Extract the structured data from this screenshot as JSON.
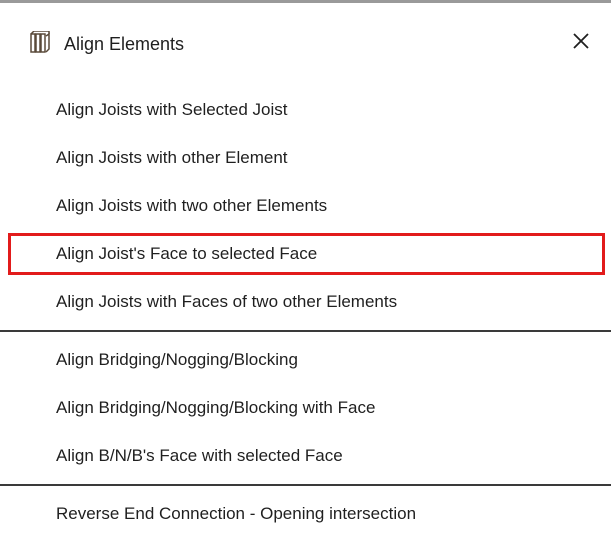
{
  "window": {
    "title": "Align Elements",
    "close_glyph": "✕"
  },
  "icons": {
    "title_icon": "joists-icon",
    "close_icon": "close-icon"
  },
  "colors": {
    "highlight_border": "#e21b1b",
    "separator": "#3a3a3a",
    "text": "#1f1f1f",
    "background": "#ffffff"
  },
  "menu": {
    "groups": [
      {
        "items": [
          {
            "label": "Align Joists with Selected Joist"
          },
          {
            "label": "Align Joists with other Element"
          },
          {
            "label": "Align Joists with two other Elements"
          },
          {
            "label": "Align Joist's Face to selected Face",
            "highlighted": true
          },
          {
            "label": "Align Joists with Faces of two other Elements"
          }
        ]
      },
      {
        "items": [
          {
            "label": "Align Bridging/Nogging/Blocking"
          },
          {
            "label": "Align Bridging/Nogging/Blocking with Face"
          },
          {
            "label": "Align B/N/B's Face with selected Face"
          }
        ]
      },
      {
        "items": [
          {
            "label": "Reverse End Connection - Opening intersection"
          }
        ]
      }
    ]
  }
}
